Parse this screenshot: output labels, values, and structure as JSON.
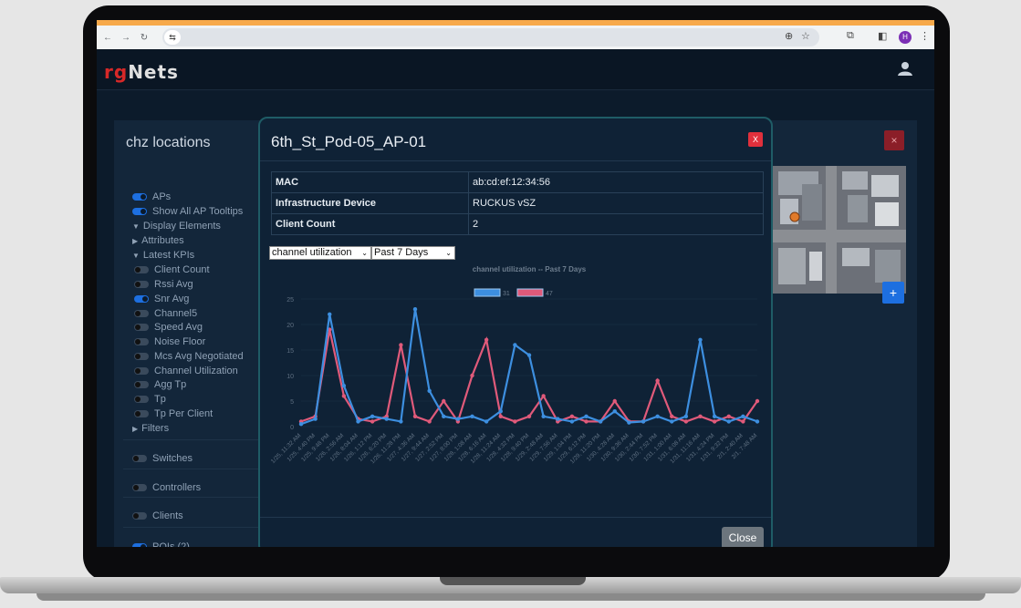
{
  "browser": {
    "site_icon": "⇆",
    "zoom_icon": "zoom-icon",
    "star_icon": "star-icon",
    "profile_initial": "H"
  },
  "app": {
    "logo_prefix": "rg",
    "logo_suffix": "Nets"
  },
  "page": {
    "title": "chz locations",
    "close_label": "×",
    "map_plus_label": "+"
  },
  "sidebar": [
    {
      "label": "APs",
      "kind": "toggle",
      "on": true
    },
    {
      "label": "Show All AP Tooltips",
      "kind": "toggle",
      "on": true
    },
    {
      "label": "Display Elements",
      "kind": "expanded"
    },
    {
      "label": "Attributes",
      "kind": "collapsed"
    },
    {
      "label": "Latest KPIs",
      "kind": "expanded"
    },
    {
      "label": "Client Count",
      "kind": "toggle",
      "on": false
    },
    {
      "label": "Rssi Avg",
      "kind": "toggle",
      "on": false
    },
    {
      "label": "Snr Avg",
      "kind": "toggle",
      "on": true
    },
    {
      "label": "Channel5",
      "kind": "toggle",
      "on": false
    },
    {
      "label": "Speed Avg",
      "kind": "toggle",
      "on": false
    },
    {
      "label": "Noise Floor",
      "kind": "toggle",
      "on": false
    },
    {
      "label": "Mcs Avg Negotiated",
      "kind": "toggle",
      "on": false
    },
    {
      "label": "Channel Utilization",
      "kind": "toggle",
      "on": false
    },
    {
      "label": "Agg Tp",
      "kind": "toggle",
      "on": false
    },
    {
      "label": "Tp",
      "kind": "toggle",
      "on": false
    },
    {
      "label": "Tp Per Client",
      "kind": "toggle",
      "on": false
    },
    {
      "label": "Filters",
      "kind": "collapsed"
    },
    {
      "label": "Switches",
      "kind": "toggle",
      "on": false
    },
    {
      "label": "Controllers",
      "kind": "toggle",
      "on": false
    },
    {
      "label": "Clients",
      "kind": "toggle",
      "on": false
    },
    {
      "label": "POIs (2)",
      "kind": "toggle",
      "on": true
    }
  ],
  "modal": {
    "title": "6th_St_Pod-05_AP-01",
    "x_label": "X",
    "rows": [
      {
        "key": "MAC",
        "value": "ab:cd:ef:12:34:56"
      },
      {
        "key": "Infrastructure Device",
        "value": "RUCKUS vSZ"
      },
      {
        "key": "Client Count",
        "value": "2"
      }
    ],
    "metric_select": "channel utilization",
    "range_select": "Past 7 Days",
    "close_label": "Close"
  },
  "chart_data": {
    "type": "line",
    "title": "channel utilization -- Past 7 Days",
    "ylim": [
      0,
      25
    ],
    "yticks": [
      0,
      5,
      10,
      15,
      20,
      25
    ],
    "legend_position": "top-center",
    "x": [
      "1/25, 11:32 AM",
      "1/25, 4:40 PM",
      "1/25, 9:48 PM",
      "1/26, 2:56 AM",
      "1/26, 8:04 AM",
      "1/26, 1:12 PM",
      "1/26, 6:20 PM",
      "1/26, 11:28 PM",
      "1/27, 4:36 AM",
      "1/27, 9:44 AM",
      "1/27, 2:52 PM",
      "1/27, 8:00 PM",
      "1/28, 1:08 AM",
      "1/28, 6:16 AM",
      "1/28, 11:24 AM",
      "1/28, 4:32 PM",
      "1/28, 9:40 PM",
      "1/29, 2:48 AM",
      "1/29, 7:56 AM",
      "1/29, 1:04 PM",
      "1/29, 6:12 PM",
      "1/29, 11:20 PM",
      "1/30, 4:28 AM",
      "1/30, 9:36 AM",
      "1/30, 2:44 PM",
      "1/30, 7:52 PM",
      "1/31, 1:00 AM",
      "1/31, 6:08 AM",
      "1/31, 11:16 AM",
      "1/31, 4:24 PM",
      "1/31, 9:32 PM",
      "2/1, 2:40 AM",
      "2/1, 7:48 AM"
    ],
    "series": [
      {
        "name": "31",
        "color": "#3d8fe0",
        "values": [
          0.5,
          1.5,
          22,
          8,
          1,
          2,
          1.5,
          1,
          23,
          7,
          2,
          1.5,
          2,
          1,
          3,
          16,
          14,
          2,
          1.5,
          1,
          2,
          1,
          3,
          0.8,
          1,
          2,
          1,
          2,
          17,
          2,
          1,
          2,
          1
        ]
      },
      {
        "name": "47",
        "color": "#e05a7a",
        "values": [
          1,
          2,
          19,
          6,
          1.5,
          1,
          2,
          16,
          2,
          1,
          5,
          1,
          10,
          17,
          2,
          1,
          2,
          6,
          1,
          2,
          1,
          1,
          5,
          1,
          1,
          9,
          2,
          1,
          2,
          1,
          2,
          1,
          5
        ]
      }
    ]
  }
}
